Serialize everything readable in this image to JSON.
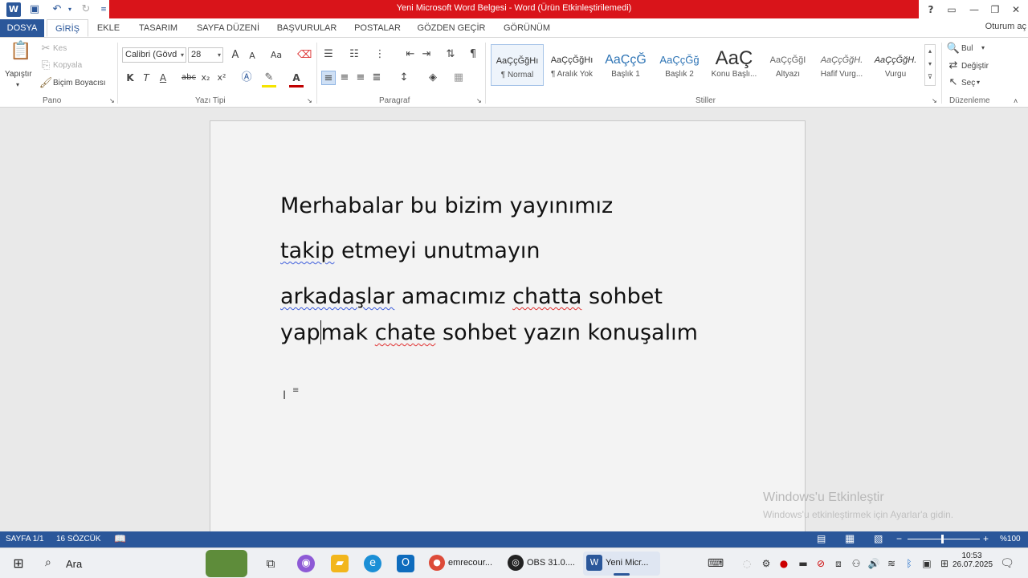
{
  "window": {
    "title": "Yeni Microsoft Word Belgesi - Word (Ürün Etkinleştirilemedi)",
    "help": "?",
    "signin": "Oturum aç"
  },
  "tabs": [
    "DOSYA",
    "GİRİŞ",
    "EKLE",
    "TASARIM",
    "SAYFA DÜZENİ",
    "BAŞVURULAR",
    "POSTALAR",
    "GÖZDEN GEÇİR",
    "GÖRÜNÜM"
  ],
  "ribbon": {
    "clipboard": {
      "paste": "Yapıştır",
      "cut": "Kes",
      "copy": "Kopyala",
      "format_painter": "Biçim Boyacısı",
      "label": "Pano"
    },
    "font": {
      "name": "Calibri (Gövd",
      "size": "28",
      "label": "Yazı Tipi",
      "bold": "K",
      "italic": "T",
      "underline": "A",
      "strike": "abc",
      "subscript": "x₂",
      "superscript": "x²",
      "grow": "A",
      "shrink": "A",
      "case": "Aa",
      "color_accent": "#c00000",
      "highlight_accent": "#f5e400"
    },
    "paragraph": {
      "label": "Paragraf",
      "pilcrow": "¶"
    },
    "styles": {
      "label": "Stiller",
      "items": [
        {
          "sample": "AaÇçĞğHı",
          "name": "¶ Normal"
        },
        {
          "sample": "AaÇçĞğHı",
          "name": "¶ Aralık Yok"
        },
        {
          "sample": "AaÇçĞ",
          "name": "Başlık 1"
        },
        {
          "sample": "AaÇçĞğ",
          "name": "Başlık 2"
        },
        {
          "sample": "AaÇ",
          "name": "Konu Başlı..."
        },
        {
          "sample": "AaÇçĞğI",
          "name": "Altyazı"
        },
        {
          "sample": "AaÇçĞğH.",
          "name": "Hafif Vurg..."
        },
        {
          "sample": "AaÇçĞğH.",
          "name": "Vurgu"
        }
      ]
    },
    "editing": {
      "find": "Bul",
      "replace": "Değiştir",
      "select": "Seç",
      "label": "Düzenleme"
    }
  },
  "document": {
    "line1": "Merhabalar bu bizim yayınımız",
    "line2_a": "takip",
    "line2_b": " etmeyi unutmayın",
    "line3_a": "arkadaşlar",
    "line3_b": " amacımız ",
    "line3_c": "chatta",
    "line3_d": " sohbet",
    "line4_a": "yap",
    "line4_b": "mak ",
    "line4_c": "chate",
    "line4_d": " sohbet yazın konuşalım"
  },
  "watermark": {
    "title": "Windows'u Etkinleştir",
    "subtitle": "Windows'u etkinleştirmek için Ayarlar'a gidin."
  },
  "statusbar": {
    "page": "SAYFA 1/1",
    "words": "16 SÖZCÜK",
    "zoom": "%100"
  },
  "taskbar": {
    "search": "Ara",
    "apps": [
      {
        "label": "emrecour...",
        "color": "#dd4b39"
      },
      {
        "label": "OBS 31.0....",
        "color": "#222222"
      },
      {
        "label": "Yeni Micr...",
        "color": "#2b579a"
      }
    ],
    "time": "10:53",
    "date": "26.07.2025"
  }
}
